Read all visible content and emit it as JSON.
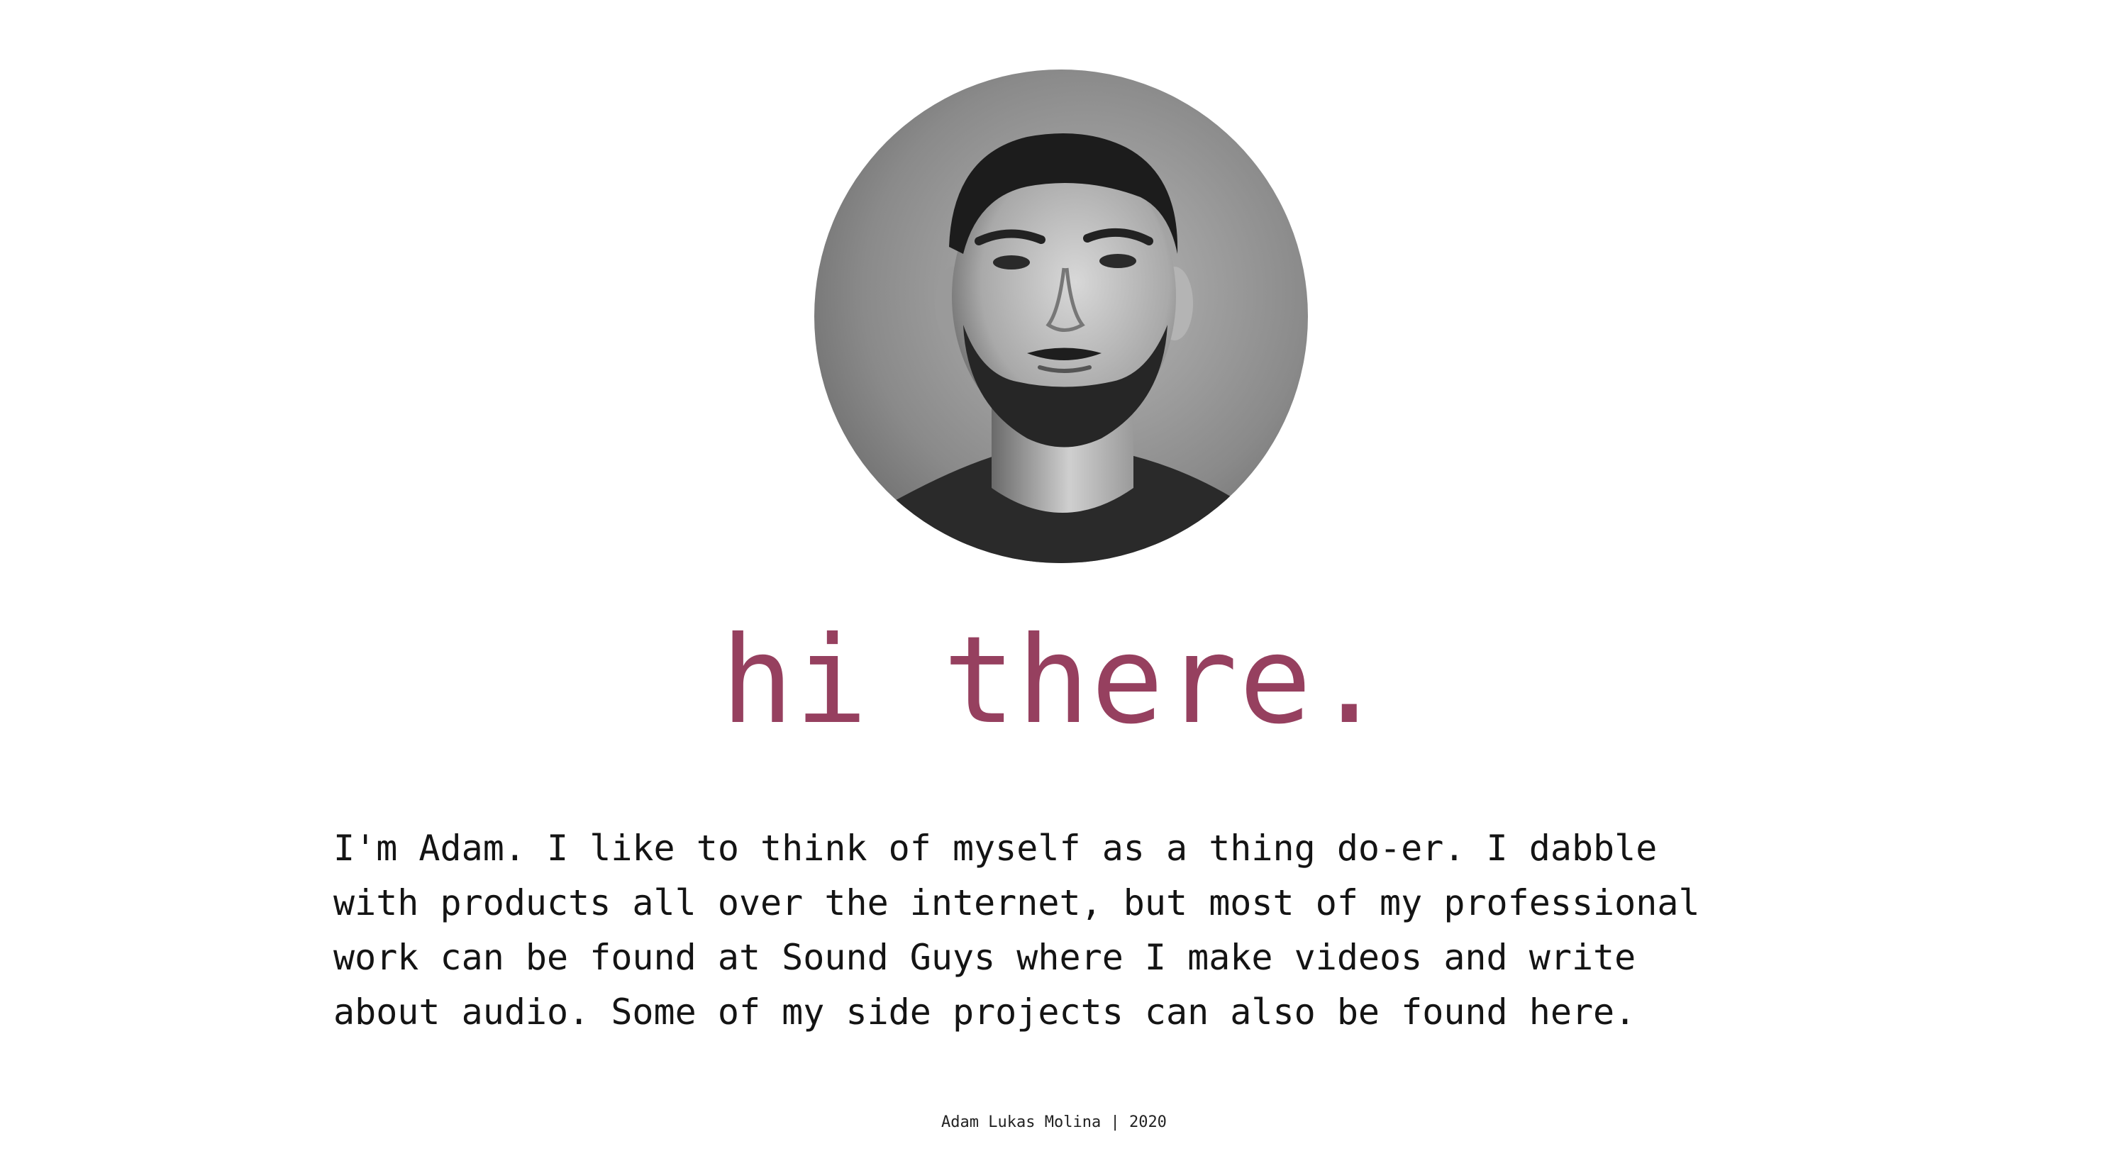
{
  "profile": {
    "photo_description_icon": "portrait-photo",
    "headline": "hi there.",
    "bio_lines": [
      "I'm Adam. I like to think of myself as a thing do-er. I dabble",
      "with products all over the internet, but most of my professional",
      "work can be found at Sound Guys where I make videos and write",
      "about audio. Some of my side projects can also be found here."
    ]
  },
  "footer": {
    "text": "Adam Lukas Molina | 2020"
  },
  "colors": {
    "accent": "#96405f",
    "text": "#141414",
    "background": "#ffffff"
  }
}
